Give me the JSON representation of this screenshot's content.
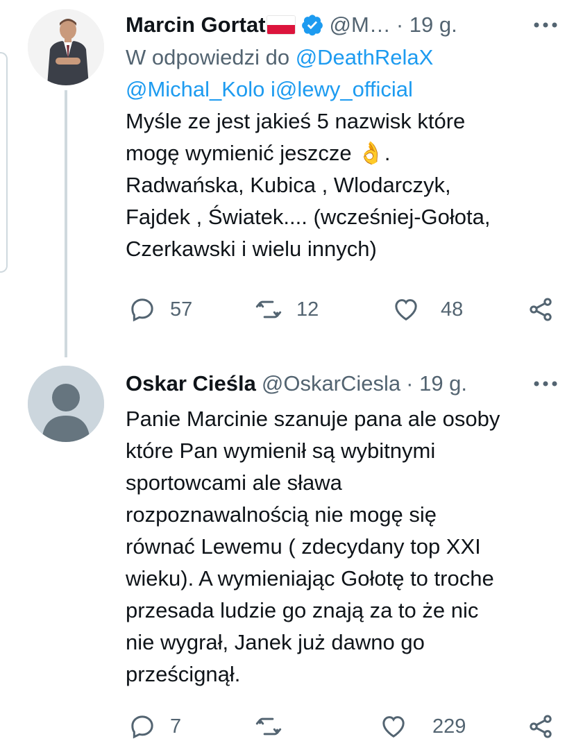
{
  "tweets": [
    {
      "name": "Marcin Gortat",
      "handle": "@M…",
      "time": "· 19 g.",
      "reply_prefix": "W odpowiedzi do",
      "reply_links": [
        "@DeathRelaX",
        "@Michal_Kolo",
        "@lewy_official"
      ],
      "reply_joiner": "i",
      "body_lines": [
        "Myśle ze jest jakieś 5 nazwisk które",
        "mogę wymienić jeszcze",
        "Radwańska, Kubica , Wlodarczyk,",
        "Fajdek , Światek.... (wcześniej-Gołota,",
        "Czerkawski i wielu innych)"
      ],
      "emoji": "👌",
      "emoji_suffix": ".",
      "replies": "57",
      "retweets": "12",
      "likes": "48"
    },
    {
      "name": "Oskar Cieśla",
      "handle": "@OskarCiesla",
      "time": "· 19 g.",
      "body_lines": [
        "Panie Marcinie szanuje pana ale osoby",
        "które Pan wymienił są wybitnymi",
        "sportowcami ale sława",
        "rozpoznawalnością nie mogę się",
        "równać Lewemu ( zdecydany top XXI",
        "wieku). A wymieniając Gołotę to troche",
        "przesada ludzie go znają za to że nic",
        "nie wygrał, Janek już dawno go",
        "prześcignął."
      ],
      "replies": "7",
      "retweets": "",
      "likes": "229"
    }
  ],
  "colors": {
    "accent": "#1d9bf0",
    "muted": "#536471",
    "text": "#0f1419",
    "flag_red": "#dc143c"
  },
  "icons": [
    "reply-icon",
    "retweet-icon",
    "like-icon",
    "share-icon",
    "more-icon",
    "verified-icon"
  ]
}
